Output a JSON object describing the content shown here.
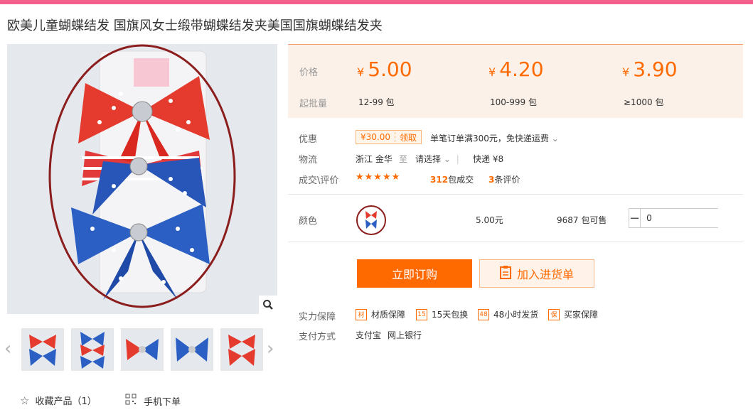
{
  "product": {
    "title": "欧美儿童蝴蝶结发 国旗风女士缎带蝴蝶结发夹美国国旗蝴蝶结发夹"
  },
  "gallery": {
    "thumbnails": [
      "thumb-1",
      "thumb-2",
      "thumb-3",
      "thumb-4",
      "thumb-5"
    ],
    "favorite_label": "收藏产品（1）",
    "mobile_label": "手机下单"
  },
  "pricing": {
    "price_label": "价格",
    "moq_label": "起批量",
    "currency": "¥",
    "tiers": [
      {
        "price": "5.00",
        "qty": "12-99 包"
      },
      {
        "price": "4.20",
        "qty": "100-999 包"
      },
      {
        "price": "3.90",
        "qty": "≥1000 包"
      }
    ]
  },
  "promo": {
    "label": "优惠",
    "coupon_amount": "¥30.00",
    "coupon_action": "领取",
    "desc": "单笔订单满300元，免快递运费"
  },
  "logistics": {
    "label": "物流",
    "origin": "浙江 金华",
    "to": "至",
    "dest": "请选择",
    "express": "快递 ¥8"
  },
  "sales": {
    "label": "成交\\评价",
    "stars": "★★★★★",
    "sold_count": "312",
    "sold_suffix": "包成交",
    "review_count": "3",
    "review_suffix": "条评价"
  },
  "variant": {
    "label": "颜色",
    "price": "5.00元",
    "stock": "9687 包可售",
    "quantity": "0"
  },
  "actions": {
    "order": "立即订购",
    "cart": "加入进货单"
  },
  "service": {
    "label": "实力保障",
    "items": [
      {
        "icon": "材",
        "text": "材质保障"
      },
      {
        "icon": "15",
        "text": "15天包换"
      },
      {
        "icon": "48",
        "text": "48小时发货"
      },
      {
        "icon": "保",
        "text": "买家保障"
      }
    ]
  },
  "payment": {
    "label": "支付方式",
    "methods": [
      "支付宝",
      "网上银行"
    ]
  },
  "colors": {
    "accent": "#ff6a00",
    "topbar": "#f5608e",
    "price_bg": "#fcf1e8"
  }
}
